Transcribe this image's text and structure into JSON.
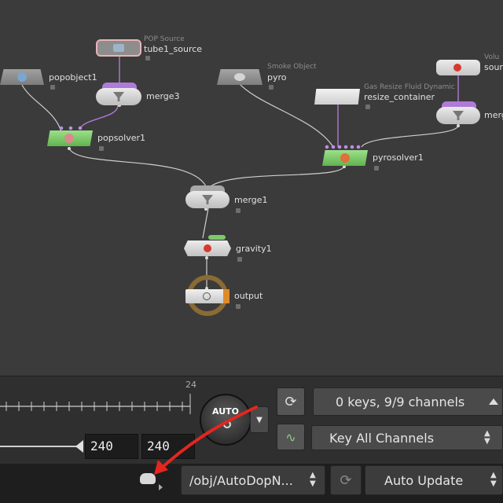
{
  "nodes": {
    "tube1_source": {
      "type": "POP Source",
      "name": "tube1_source"
    },
    "popobject1": {
      "name": "popobject1"
    },
    "merge3": {
      "name": "merge3"
    },
    "popsolver1": {
      "name": "popsolver1"
    },
    "pyro": {
      "type": "Smoke Object",
      "name": "pyro"
    },
    "resize_container": {
      "type": "Gas Resize Fluid Dynamic",
      "name": "resize_container"
    },
    "source_vol": {
      "type": "Volu",
      "name": "sourc"
    },
    "merge_right": {
      "name": "merg"
    },
    "pyrosolver1": {
      "name": "pyrosolver1"
    },
    "merge1": {
      "name": "merge1"
    },
    "gravity1": {
      "name": "gravity1"
    },
    "output": {
      "name": "output"
    }
  },
  "timeline": {
    "ruler_label": "24",
    "range_start": "240",
    "range_end": "240",
    "auto_key_label": "AUTO",
    "keys_status": "0 keys, 9/9 channels",
    "key_all_channels": "Key All Channels"
  },
  "status_bar": {
    "path": "/obj/AutoDopN...",
    "update_mode": "Auto Update"
  },
  "colors": {
    "network_bg": "#3b3b3b",
    "solver_green": "#7ec96a",
    "wire_purple": "#b07ad8",
    "annotation_red": "#e3261f"
  }
}
